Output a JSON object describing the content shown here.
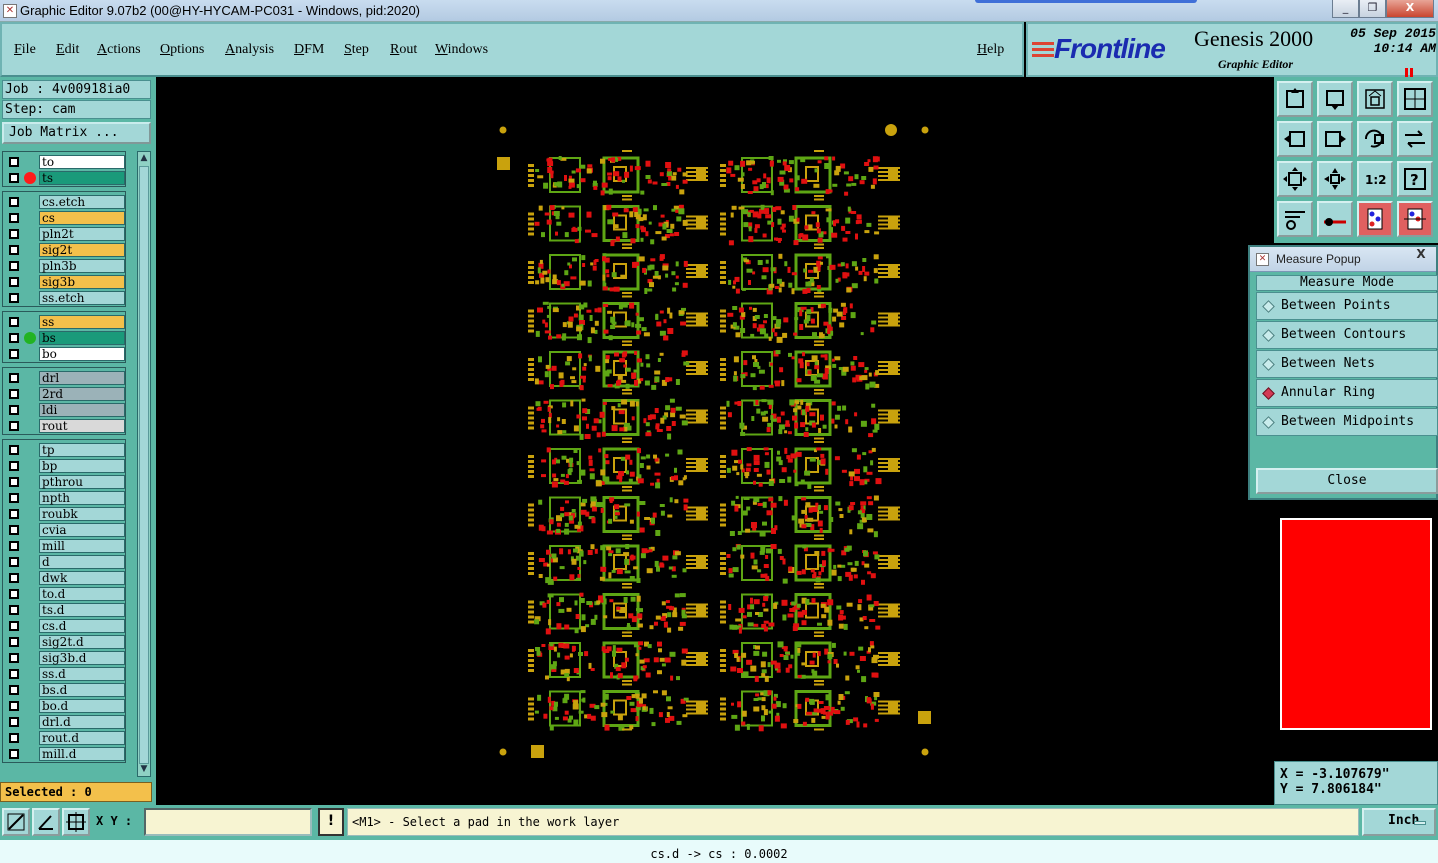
{
  "window": {
    "title": "Graphic Editor 9.07b2 (00@HY-HYCAM-PC031 - Windows, pid:2020)",
    "controls": [
      "_",
      "❐",
      "X"
    ]
  },
  "menu": [
    "File",
    "Edit",
    "Actions",
    "Options",
    "Analysis",
    "DFM",
    "Step",
    "Rout",
    "Windows"
  ],
  "help_label": "Help",
  "brand": {
    "logo": "Frontline",
    "product": "Genesis 2000",
    "subtitle": "Graphic Editor",
    "date": "05 Sep 2015",
    "time": "10:14 AM"
  },
  "job": {
    "job_label": "Job : 4v00918ia0",
    "step_label": "Step: cam",
    "matrix_button": "Job Matrix ..."
  },
  "layers": [
    {
      "name": "to",
      "color": "#ffffff",
      "marker": null
    },
    {
      "name": "ts",
      "color": "#1a9a7a",
      "marker": "#ff1a1a"
    },
    {
      "name": "cs.etch",
      "color": "#a3d7d7",
      "marker": null
    },
    {
      "name": "cs",
      "color": "#f3c04b",
      "marker": null
    },
    {
      "name": "pln2t",
      "color": "#a3d7d7",
      "marker": null
    },
    {
      "name": "sig2t",
      "color": "#f3c04b",
      "marker": null
    },
    {
      "name": "pln3b",
      "color": "#a3d7d7",
      "marker": null
    },
    {
      "name": "sig3b",
      "color": "#f3c04b",
      "marker": null
    },
    {
      "name": "ss.etch",
      "color": "#a3d7d7",
      "marker": null
    },
    {
      "name": "ss",
      "color": "#f3c04b",
      "marker": null
    },
    {
      "name": "bs",
      "color": "#1a9a7a",
      "marker": "#22b322"
    },
    {
      "name": "bo",
      "color": "#ffffff",
      "marker": null
    },
    {
      "name": "drl",
      "color": "#9bb2b8",
      "marker": null
    },
    {
      "name": "2rd",
      "color": "#9bb2b8",
      "marker": null
    },
    {
      "name": "ldi",
      "color": "#9bb2b8",
      "marker": null
    },
    {
      "name": "rout",
      "color": "#d9d9d9",
      "marker": null
    },
    {
      "name": "tp",
      "color": "#a3d7d7",
      "marker": null
    },
    {
      "name": "bp",
      "color": "#a3d7d7",
      "marker": null
    },
    {
      "name": "pthrou",
      "color": "#a3d7d7",
      "marker": null
    },
    {
      "name": "npth",
      "color": "#a3d7d7",
      "marker": null
    },
    {
      "name": "roubk",
      "color": "#a3d7d7",
      "marker": null
    },
    {
      "name": "cvia",
      "color": "#a3d7d7",
      "marker": null
    },
    {
      "name": "mill",
      "color": "#a3d7d7",
      "marker": null
    },
    {
      "name": "d",
      "color": "#a3d7d7",
      "marker": null
    },
    {
      "name": "dwk",
      "color": "#a3d7d7",
      "marker": null
    },
    {
      "name": "to.d",
      "color": "#a3d7d7",
      "marker": null
    },
    {
      "name": "ts.d",
      "color": "#a3d7d7",
      "marker": null
    },
    {
      "name": "cs.d",
      "color": "#a3d7d7",
      "marker": null
    },
    {
      "name": "sig2t.d",
      "color": "#a3d7d7",
      "marker": null
    },
    {
      "name": "sig3b.d",
      "color": "#a3d7d7",
      "marker": null
    },
    {
      "name": "ss.d",
      "color": "#a3d7d7",
      "marker": null
    },
    {
      "name": "bs.d",
      "color": "#a3d7d7",
      "marker": null
    },
    {
      "name": "bo.d",
      "color": "#a3d7d7",
      "marker": null
    },
    {
      "name": "drl.d",
      "color": "#a3d7d7",
      "marker": null
    },
    {
      "name": "rout.d",
      "color": "#a3d7d7",
      "marker": null
    },
    {
      "name": "mill.d",
      "color": "#a3d7d7",
      "marker": null
    }
  ],
  "selected_label": "Selected : 0",
  "tools": [
    "zoom-home-icon",
    "zoom-fit-icon",
    "zoom-profile-icon",
    "zoom-window-icon",
    "pan-left-icon",
    "pan-right-icon",
    "zoom-back-icon",
    "redraw-icon",
    "zoom-center-icon",
    "zoom-in-icon",
    "scale-1-2-icon",
    "help-icon",
    "snap-icon",
    "net-icon",
    "layers-icon",
    "layers-active-icon"
  ],
  "tool_texts": {
    "scale": "1:2",
    "help": "?"
  },
  "measure_popup": {
    "title": "Measure Popup",
    "close_x": "X",
    "mode_header": "Measure Mode",
    "options": [
      {
        "label": "Between Points",
        "selected": false
      },
      {
        "label": "Between Contours",
        "selected": false
      },
      {
        "label": "Between Nets",
        "selected": false
      },
      {
        "label": "Annular Ring",
        "selected": true
      },
      {
        "label": "Between Midpoints",
        "selected": false
      }
    ],
    "close_label": "Close"
  },
  "coordinates": {
    "x": "X = -3.107679\"",
    "y": "Y = 7.806184\""
  },
  "bottom": {
    "xy_label": "X Y :",
    "xy_value": "",
    "warn_label": "!",
    "message": "<M1> - Select a pad in the work layer",
    "unit": "Inch"
  },
  "status": "cs.d -> cs : 0.0002",
  "colors": {
    "panel": "#5bb7a5",
    "light_panel": "#a3d7d7",
    "board_pad": "#c9a20d",
    "board_green": "#5ea614",
    "board_red": "#e01010"
  },
  "board": {
    "rows": 12,
    "columns": 2
  }
}
